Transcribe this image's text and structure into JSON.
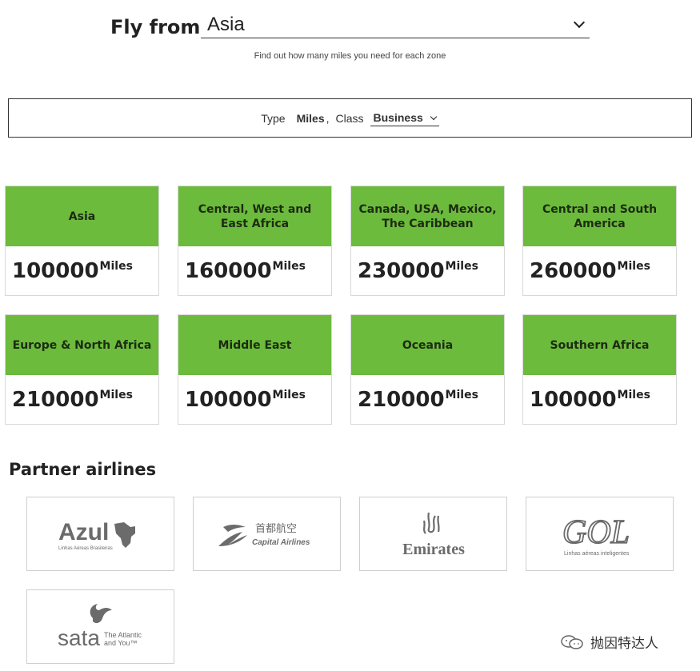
{
  "header": {
    "fly_from_label": "Fly from",
    "fly_from_value": "Asia",
    "subtitle": "Find out how many miles you need for each zone"
  },
  "filter": {
    "type_label": "Type",
    "type_value": "Miles",
    "comma": ",",
    "class_label": "Class",
    "class_value": "Business"
  },
  "zones": [
    {
      "name": "Asia",
      "miles": "100000",
      "unit": "Miles"
    },
    {
      "name": "Central, West and East Africa",
      "miles": "160000",
      "unit": "Miles"
    },
    {
      "name": "Canada, USA, Mexico, The Caribbean",
      "miles": "230000",
      "unit": "Miles"
    },
    {
      "name": "Central and South America",
      "miles": "260000",
      "unit": "Miles"
    },
    {
      "name": "Europe & North Africa",
      "miles": "210000",
      "unit": "Miles"
    },
    {
      "name": "Middle East",
      "miles": "100000",
      "unit": "Miles"
    },
    {
      "name": "Oceania",
      "miles": "210000",
      "unit": "Miles"
    },
    {
      "name": "Southern Africa",
      "miles": "100000",
      "unit": "Miles"
    }
  ],
  "partners": {
    "title": "Partner airlines",
    "logos": [
      {
        "name": "Azul",
        "tagline": "Linhas Aéreas Brasileiras"
      },
      {
        "name": "Capital Airlines",
        "chinese": "首都航空"
      },
      {
        "name": "Emirates"
      },
      {
        "name": "GOL",
        "tagline": "Linhas aéreas inteligentes"
      },
      {
        "name": "sata",
        "tagline_1": "The Atlantic",
        "tagline_2": "and You™"
      }
    ]
  },
  "watermark": {
    "text": "抛因特达人"
  },
  "colors": {
    "zone_header": "#6cbb3c",
    "logo_gray": "#6b6b6b"
  }
}
